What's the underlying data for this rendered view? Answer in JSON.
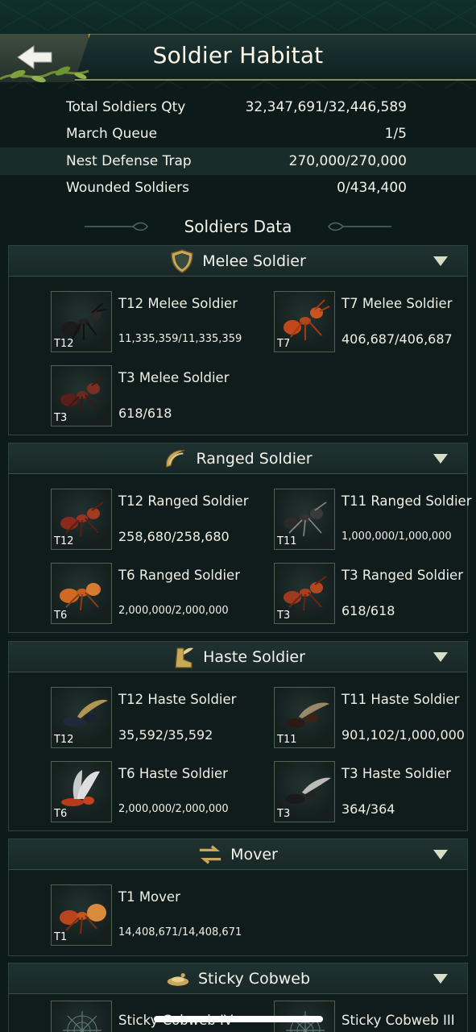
{
  "header": {
    "title": "Soldier Habitat"
  },
  "stats": [
    {
      "label": "Total Soldiers Qty",
      "value": "32,347,691/32,446,589"
    },
    {
      "label": "March Queue",
      "value": "1/5"
    },
    {
      "label": "Nest Defense Trap",
      "value": "270,000/270,000"
    },
    {
      "label": "Wounded Soldiers",
      "value": "0/434,400"
    }
  ],
  "section_title": "Soldiers Data",
  "groups": {
    "melee": {
      "label": "Melee Soldier",
      "units": [
        {
          "name": "T12 Melee Soldier",
          "qty": "11,335,359/11,335,359",
          "tier": "T12"
        },
        {
          "name": "T7 Melee Soldier",
          "qty": "406,687/406,687",
          "tier": "T7"
        },
        {
          "name": "T3 Melee Soldier",
          "qty": "618/618",
          "tier": "T3"
        }
      ]
    },
    "ranged": {
      "label": "Ranged Soldier",
      "units": [
        {
          "name": "T12 Ranged Soldier",
          "qty": "258,680/258,680",
          "tier": "T12"
        },
        {
          "name": "T11 Ranged Soldier",
          "qty": "1,000,000/1,000,000",
          "tier": "T11"
        },
        {
          "name": "T6 Ranged Soldier",
          "qty": "2,000,000/2,000,000",
          "tier": "T6"
        },
        {
          "name": "T3 Ranged Soldier",
          "qty": "618/618",
          "tier": "T3"
        }
      ]
    },
    "haste": {
      "label": "Haste Soldier",
      "units": [
        {
          "name": "T12 Haste Soldier",
          "qty": "35,592/35,592",
          "tier": "T12"
        },
        {
          "name": "T11 Haste Soldier",
          "qty": "901,102/1,000,000",
          "tier": "T11"
        },
        {
          "name": "T6 Haste Soldier",
          "qty": "2,000,000/2,000,000",
          "tier": "T6"
        },
        {
          "name": "T3 Haste Soldier",
          "qty": "364/364",
          "tier": "T3"
        }
      ]
    },
    "mover": {
      "label": "Mover",
      "units": [
        {
          "name": "T1 Mover",
          "qty": "14,408,671/14,408,671",
          "tier": "T1"
        }
      ]
    },
    "cobweb": {
      "label": "Sticky Cobweb",
      "units": [
        {
          "name": "Sticky Cobweb IV",
          "qty": ""
        },
        {
          "name": "Sticky Cobweb III",
          "qty": ""
        }
      ]
    }
  },
  "colors": {
    "accent": "#b7a664",
    "panel": "#101c1c",
    "header": "#1f3231"
  },
  "icons": [
    "back-arrow-icon",
    "shield-icon",
    "bow-icon",
    "winged-boot-icon",
    "mover-icon",
    "cobweb-icon",
    "chevron-down-icon"
  ]
}
